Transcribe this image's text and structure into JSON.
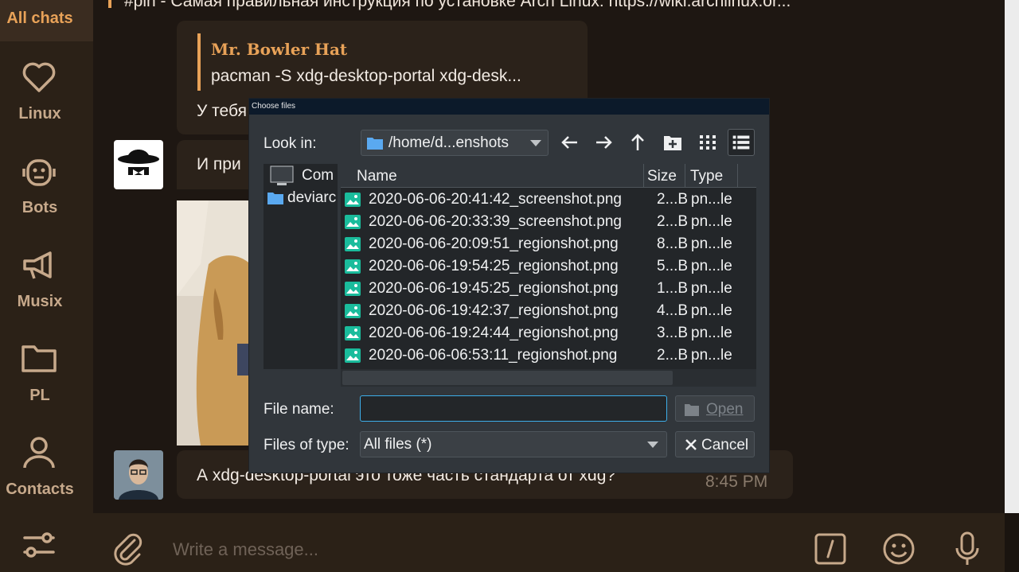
{
  "sidebar": {
    "items": [
      {
        "label": "All chats",
        "icon": "chats-icon",
        "active": true
      },
      {
        "label": "Linux",
        "icon": "heart-icon"
      },
      {
        "label": "Bots",
        "icon": "robot-icon"
      },
      {
        "label": "Musix",
        "icon": "megaphone-icon"
      },
      {
        "label": "PL",
        "icon": "folder-icon"
      },
      {
        "label": "Contacts",
        "icon": "person-icon"
      },
      {
        "label": "",
        "icon": "settings-sliders-icon"
      }
    ]
  },
  "chat": {
    "pinned_text": "#pin - Самая правильная инструкция по установке Arch Linux: https://wiki.archlinux.or...",
    "messages": [
      {
        "reply_name": "Mr. Bowler Hat",
        "reply_text": "pacman -S xdg-desktop-portal xdg-desk...",
        "text": "У тебя"
      },
      {
        "text": "И при"
      },
      {
        "text": "А xdg-desktop-portal это тоже часть стандарта от xdg?",
        "time": "8:45 PM"
      }
    ]
  },
  "composer": {
    "placeholder": "Write a message..."
  },
  "dialog": {
    "title": "Choose files",
    "look_in_label": "Look in:",
    "look_in_value": "/home/d...enshots",
    "places": [
      "Com",
      "deviarc"
    ],
    "columns": {
      "name": "Name",
      "size": "Size",
      "type": "Type"
    },
    "files": [
      {
        "name": "2020-06-06-20:41:42_screenshot.png",
        "size": "2...B",
        "type": "pn...le"
      },
      {
        "name": "2020-06-06-20:33:39_screenshot.png",
        "size": "2...B",
        "type": "pn...le"
      },
      {
        "name": "2020-06-06-20:09:51_regionshot.png",
        "size": "8...B",
        "type": "pn...le"
      },
      {
        "name": "2020-06-06-19:54:25_regionshot.png",
        "size": "5...B",
        "type": "pn...le"
      },
      {
        "name": "2020-06-06-19:45:25_regionshot.png",
        "size": "1...B",
        "type": "pn...le"
      },
      {
        "name": "2020-06-06-19:42:37_regionshot.png",
        "size": "4...B",
        "type": "pn...le"
      },
      {
        "name": "2020-06-06-19:24:44_regionshot.png",
        "size": "3...B",
        "type": "pn...le"
      },
      {
        "name": "2020-06-06-06:53:11_regionshot.png",
        "size": "2...B",
        "type": "pn...le"
      }
    ],
    "file_name_label": "File name:",
    "file_name_value": "",
    "files_of_type_label": "Files of type:",
    "files_of_type_value": "All files (*)",
    "open_label": "Open",
    "cancel_label": "Cancel"
  },
  "colors": {
    "accent": "#e8a258",
    "sidebar_bg": "#2b2117",
    "chat_bg": "#1e1712",
    "dialog_bg": "#31363b",
    "dialog_focus": "#3daee9"
  }
}
